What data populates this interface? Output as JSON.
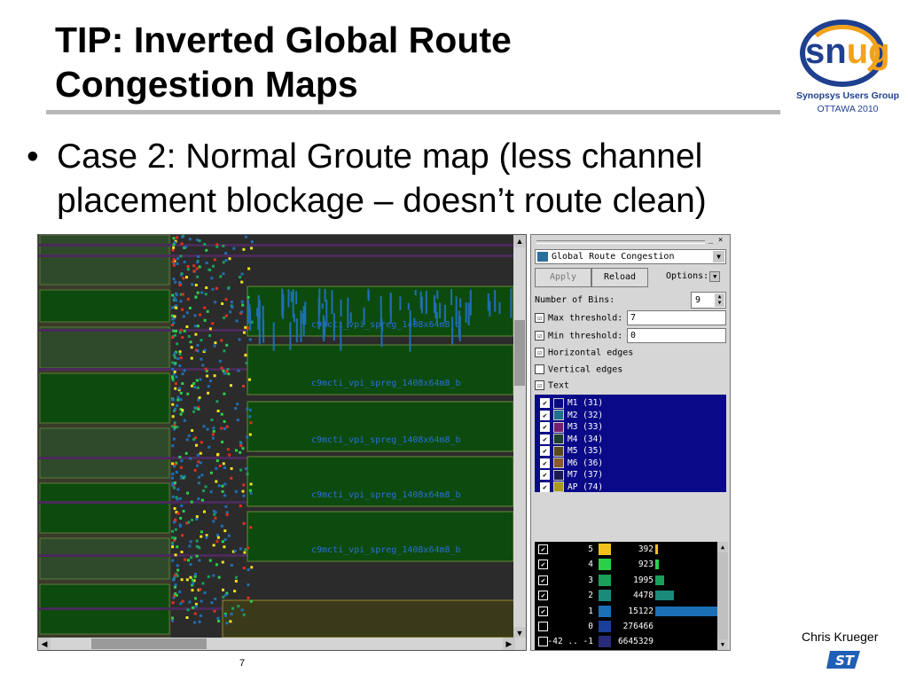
{
  "slide": {
    "title_line1": "TIP: Inverted Global Route",
    "title_line2": "Congestion Maps",
    "bullet_symbol": "•",
    "bullet_text": "Case 2: Normal Groute map (less channel placement blockage – doesn’t route clean)",
    "author": "Chris Krueger",
    "page_number": "7"
  },
  "logo": {
    "main_text_part1": "sn",
    "main_text_part2": "ug",
    "subtitle": "Synopsys Users Group",
    "location": "OTTAWA 2010",
    "colors": {
      "blue": "#1f3f8f",
      "orange": "#f2a21b"
    }
  },
  "map": {
    "macro_labels": [
      "c9mcti_vpi_spreg_1408x64m8_b",
      "c9mcti_vpi_spreg_1408x64m8_b",
      "c9mcti_vpi_spreg_1408x64m8_b",
      "c9mcti_vpi_spreg_1408x64m8_b",
      "c9mcti_vpi_spreg_1408x64m8_b"
    ],
    "colors": {
      "macro": "#0d4a0d",
      "background": "#2a2a2a",
      "congestion_low": "#1e6fb5",
      "congestion_high": "#f2e31a"
    }
  },
  "panel": {
    "close_glyphs": "_ ×",
    "dropdown_label": "Global Route Congestion",
    "apply_label": "Apply",
    "reload_label": "Reload",
    "options_label": "Options:",
    "bins_label": "Number of Bins:",
    "bins_value": "9",
    "max_threshold_label": "Max threshold:",
    "max_threshold_value": "7",
    "min_threshold_label": "Min threshold:",
    "min_threshold_value": "0",
    "horizontal_edges_label": "Horizontal edges",
    "vertical_edges_label": "Vertical edges",
    "text_label": "Text",
    "checks": {
      "max": "☑",
      "min": "☑",
      "horizontal": "☑",
      "vertical": "",
      "text": "☑"
    },
    "layers": [
      {
        "label": "M1 (31)",
        "color": "#0a0a88"
      },
      {
        "label": "M2 (32)",
        "color": "#1f6f8f"
      },
      {
        "label": "M3 (33)",
        "color": "#7a1f6f"
      },
      {
        "label": "M4 (34)",
        "color": "#1f3f2f"
      },
      {
        "label": "M5 (35)",
        "color": "#5a4a1a"
      },
      {
        "label": "M6 (36)",
        "color": "#8a5a2a"
      },
      {
        "label": "M7 (37)",
        "color": "#1a1a5a"
      },
      {
        "label": "AP (74)",
        "color": "#a89a1a"
      }
    ],
    "bins": [
      {
        "level": "5",
        "count": "392",
        "color": "#f2c21a",
        "checked": true,
        "frac": 0.02
      },
      {
        "level": "4",
        "count": "923",
        "color": "#2ad04a",
        "checked": true,
        "frac": 0.04
      },
      {
        "level": "3",
        "count": "1995",
        "color": "#1aa05a",
        "checked": true,
        "frac": 0.09
      },
      {
        "level": "2",
        "count": "4478",
        "color": "#1a8a7a",
        "checked": true,
        "frac": 0.19
      },
      {
        "level": "1",
        "count": "15122",
        "color": "#1a6fb5",
        "checked": true,
        "frac": 0.66
      },
      {
        "level": "0",
        "count": "276466",
        "color": "#1a3f9a",
        "checked": false,
        "frac": 0
      },
      {
        "level": "-42 .. -1",
        "count": "6645329",
        "color": "#2a2a7a",
        "checked": false,
        "frac": 0
      }
    ]
  }
}
